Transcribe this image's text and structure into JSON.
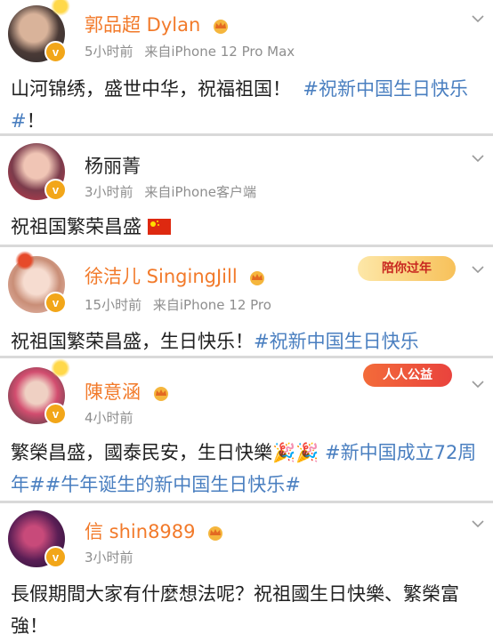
{
  "posts": [
    {
      "name": "郭品超 Dylan",
      "time": "5小时前",
      "source": "来自iPhone 12 Pro Max",
      "text": "山河锦绣，盛世中华，祝福祖国！",
      "tags": [
        "#祝新中国生日快乐#",
        "！"
      ]
    },
    {
      "name": "杨丽菁",
      "time": "3小时前",
      "source": "来自iPhone客户端",
      "text": "祝祖国繁荣昌盛",
      "tags": []
    },
    {
      "name": "徐洁儿 SingingJill",
      "time": "15小时前",
      "source": "来自iPhone 12 Pro",
      "text": "祝祖国繁荣昌盛，生日快乐！",
      "tags": [
        "#祝新中国生日快乐"
      ],
      "ribbon": "陪你过年"
    },
    {
      "name": "陳意涵",
      "time": "4小时前",
      "source": "",
      "text": "繁榮昌盛，國泰民安，生日快樂",
      "tags": [
        "#新中国成立72周年#",
        "#牛年诞生的新中国生日快乐#"
      ],
      "ribbon": "人人公益"
    },
    {
      "name": "信 shin8989",
      "time": "3小时前",
      "source": "",
      "text": "長假期間大家有什麼想法呢？祝祖國生日快樂、繁榮富強！",
      "tags": []
    }
  ],
  "colors": {
    "accent_name": "#f27a2a",
    "hashtag": "#4a7fc0",
    "meta": "#8e8e8e",
    "verified_badge": "#f2a619"
  }
}
